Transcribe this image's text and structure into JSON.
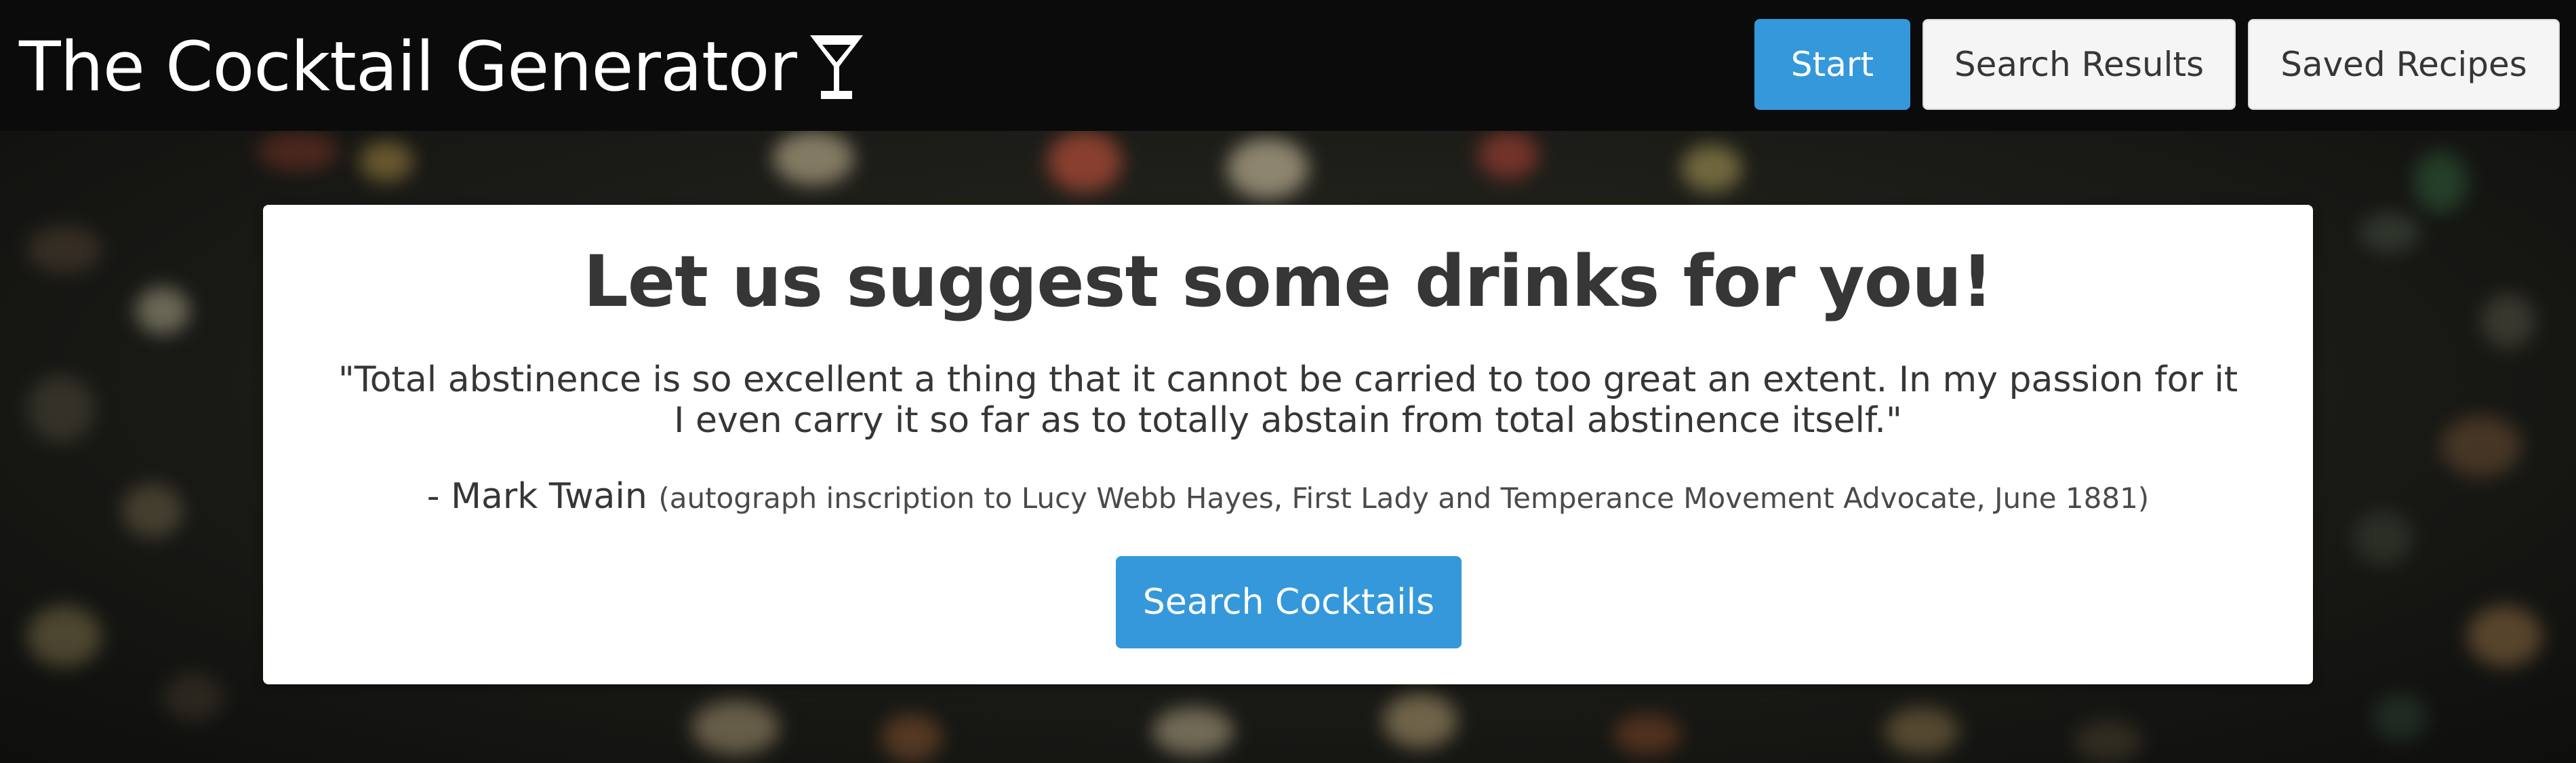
{
  "navbar": {
    "brand_title": "The Cocktail Generator",
    "brand_icon": "cocktail-glass-icon",
    "buttons": {
      "start": "Start",
      "search_results": "Search Results",
      "saved_recipes": "Saved Recipes"
    }
  },
  "hero": {
    "title": "Let us suggest some drinks for you!",
    "quote": "\"Total abstinence is so excellent a thing that it cannot be carried to too great an extent. In my passion for it I even carry it so far as to totally abstain from total abstinence itself.\"",
    "author": "- Mark Twain",
    "source": "(autograph inscription to Lucy Webb Hayes, First Lady and Temperance Movement Advocate, June 1881)",
    "search_button": "Search Cocktails"
  },
  "colors": {
    "primary": "#3498db",
    "navbar_bg": "#0b0b0b",
    "card_bg": "#ffffff",
    "text": "#363636"
  }
}
